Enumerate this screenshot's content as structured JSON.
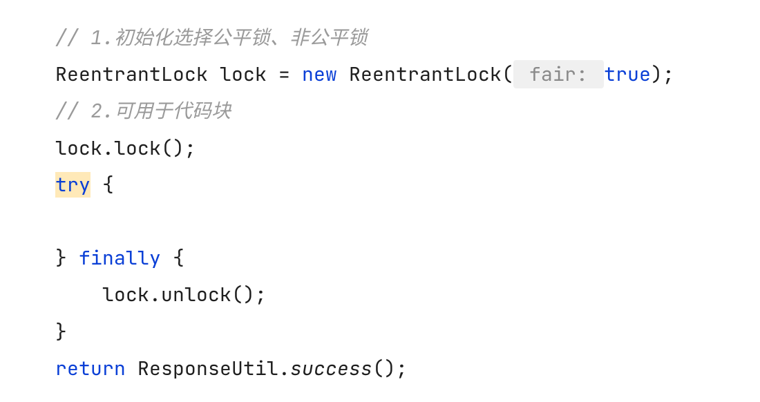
{
  "code": {
    "line1_comment": "// 1.初始化选择公平锁、非公平锁",
    "line2_a": "ReentrantLock lock = ",
    "line2_new": "new",
    "line2_b": " ReentrantLock(",
    "line2_hint": " fair: ",
    "line2_true": "true",
    "line2_c": ");",
    "line3_comment": "// 2.可用于代码块",
    "line4": "lock.lock();",
    "line5_try": "try",
    "line5_rest": " {",
    "line6": "",
    "line7_a": "} ",
    "line7_finally": "finally",
    "line7_b": " {",
    "line8": "    lock.unlock();",
    "line9": "}",
    "line10_return": "return",
    "line10_a": " ResponseUtil.",
    "line10_success": "success",
    "line10_b": "();"
  }
}
